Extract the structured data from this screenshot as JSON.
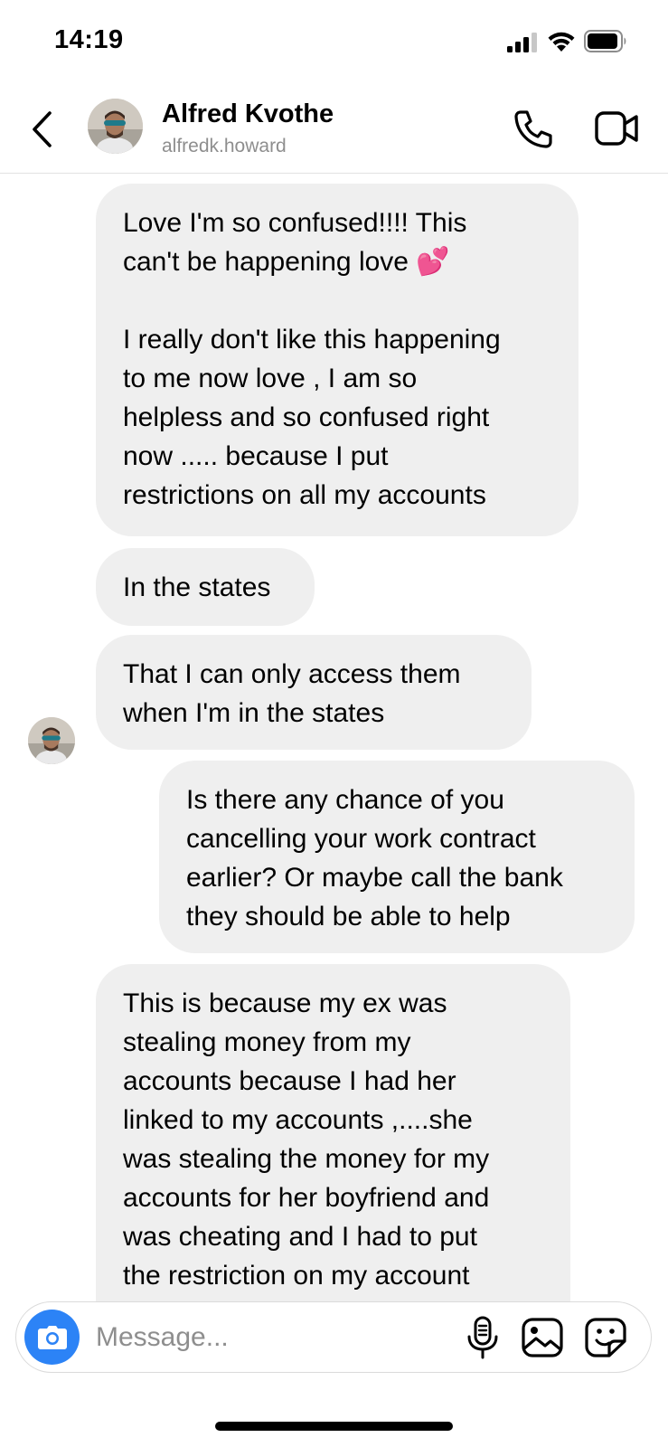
{
  "status_bar": {
    "time": "14:19"
  },
  "header": {
    "name": "Alfred Kvothe",
    "username": "alfredk.howard"
  },
  "messages": [
    {
      "direction": "incoming",
      "text": "Love I'm so confused!!!! This\ncan't be happening love 💕\n\nI really don't like this happening\nto me now love , I am so\nhelpless and so confused right\nnow ..... because I put\nrestrictions on all my accounts"
    },
    {
      "direction": "incoming",
      "text": "In the states"
    },
    {
      "direction": "incoming",
      "text": "That I can only access them\nwhen I'm in the states"
    },
    {
      "direction": "outgoing",
      "text": "Is there any chance of you\ncancelling your work contract\nearlier? Or maybe call the bank\nthey should be able to help"
    },
    {
      "direction": "incoming",
      "text": "This is because my ex was\nstealing money from my\naccounts because I had her\nlinked to my accounts ,....she\nwas stealing the money for my\naccounts for her boyfriend and\nwas cheating and I had to put\nthe restriction on my account"
    }
  ],
  "composer": {
    "placeholder": "Message..."
  },
  "colors": {
    "bubble_bg": "#efefef",
    "camera_button": "#2c83f6",
    "secondary_text": "#8e8e8e"
  },
  "icons": {
    "back": "chevron-left-icon",
    "call": "phone-icon",
    "video": "video-camera-icon",
    "camera": "camera-icon",
    "mic": "microphone-icon",
    "gallery": "image-icon",
    "sticker": "sticker-icon"
  }
}
